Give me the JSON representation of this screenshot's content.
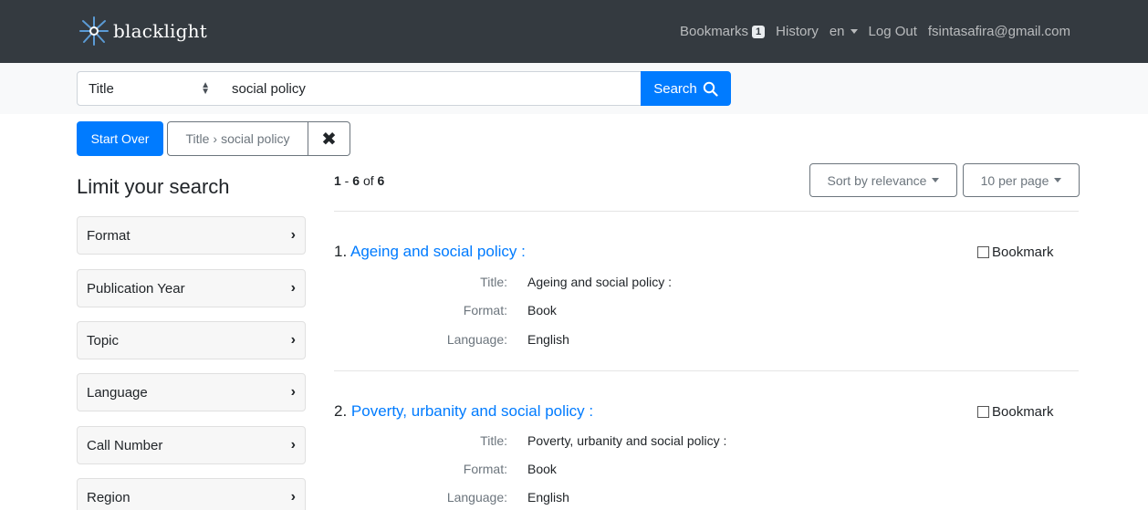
{
  "navbar": {
    "brand": "blacklight",
    "bookmarks_label": "Bookmarks",
    "bookmarks_count": "1",
    "history_label": "History",
    "language": "en",
    "logout_label": "Log Out",
    "user_email": "fsintasafira@gmail.com"
  },
  "search": {
    "field": "Title",
    "query": "social policy",
    "button_label": "Search"
  },
  "constraints": {
    "start_over": "Start Over",
    "constraint_field": "Title",
    "constraint_value": "social policy",
    "remove_icon": "✖"
  },
  "sidebar": {
    "title": "Limit your search",
    "facets": [
      {
        "label": "Format"
      },
      {
        "label": "Publication Year"
      },
      {
        "label": "Topic"
      },
      {
        "label": "Language"
      },
      {
        "label": "Call Number"
      },
      {
        "label": "Region"
      }
    ]
  },
  "results": {
    "range_start": "1",
    "range_end": "6",
    "of_label": "of",
    "total": "6",
    "sort_label": "Sort by relevance",
    "per_page_label": "10 per page",
    "bookmark_label": "Bookmark",
    "documents": [
      {
        "index": "1.",
        "title": "Ageing and social policy :",
        "fields": [
          {
            "label": "Title:",
            "value": "Ageing and social policy :"
          },
          {
            "label": "Format:",
            "value": "Book"
          },
          {
            "label": "Language:",
            "value": "English"
          }
        ]
      },
      {
        "index": "2.",
        "title": "Poverty, urbanity and social policy :",
        "fields": [
          {
            "label": "Title:",
            "value": "Poverty, urbanity and social policy :"
          },
          {
            "label": "Format:",
            "value": "Book"
          },
          {
            "label": "Language:",
            "value": "English"
          }
        ]
      }
    ]
  },
  "colors": {
    "navbar_bg": "#343a40",
    "primary": "#007bff",
    "secondary": "#6c757d"
  },
  "icons": {
    "brand": "blacklight-logo-icon",
    "search": "magnifier-icon",
    "remove": "remove-x-icon",
    "facet_toggle": "chevron-right-icon",
    "dropdown": "caret-down-icon",
    "field_select": "up-down-arrows-icon"
  }
}
